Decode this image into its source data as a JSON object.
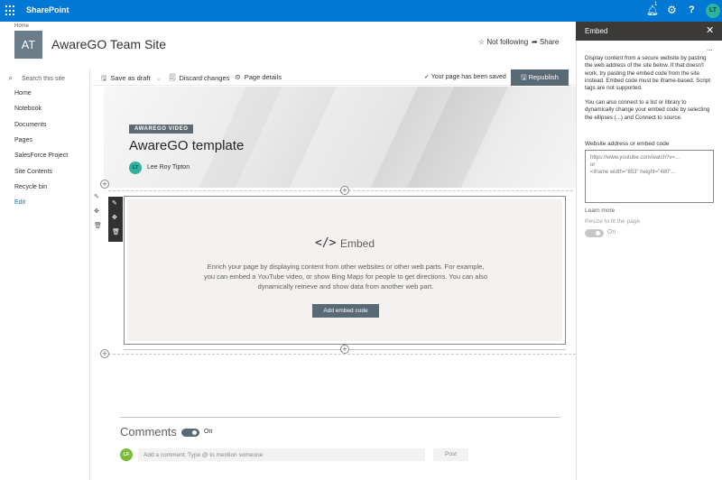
{
  "suitebar": {
    "brand": "SharePoint",
    "notification_count": "1",
    "user_initials": "LT"
  },
  "site": {
    "breadcrumb": "Home",
    "logo_initials": "AT",
    "title": "AwareGO Team Site",
    "follow_label": "Not following",
    "share_label": "Share"
  },
  "leftnav": {
    "search_placeholder": "Search this site",
    "items": [
      "Home",
      "Notebook",
      "Documents",
      "Pages",
      "SalesForce Project",
      "Site Contents",
      "Recycle bin"
    ],
    "edit_label": "Edit"
  },
  "commandbar": {
    "save_draft": "Save as draft",
    "discard": "Discard changes",
    "page_details": "Page details",
    "saved_status": "Your page has been saved",
    "republish": "Republish"
  },
  "hero": {
    "tag": "AWAREGO VIDEO",
    "title": "AwareGO template",
    "author_initials": "LT",
    "author_name": "Lee Roy Tipton"
  },
  "embed_webpart": {
    "glyph": "</>",
    "title": "Embed",
    "description": "Enrich your page by displaying content from other websites or other web parts. For example, you can embed a YouTube video, or show Bing Maps for people to get directions. You can also dynamically retrieve and show data from another web part.",
    "button": "Add embed code"
  },
  "comments": {
    "title": "Comments",
    "toggle_state": "On",
    "commenter_initials": "LF",
    "input_placeholder": "Add a comment. Type @ to mention someone",
    "post_label": "Post"
  },
  "panel": {
    "title": "Embed",
    "more": "...",
    "para1": "Display content from a secure website by pasting the web address of the site below. If that doesn't work, try pasting the embed code from the site instead. Embed code must be iframe-based. Script tags are not supported.",
    "para2": "You can also connect to a list or library to dynamically change your embed code by selecting the ellipses (...) and Connect to source.",
    "address_label": "Website address or embed code",
    "address_placeholder": "https://www.youtube.com/watch?v=...\nor\n<iframe width=\"853\" height=\"480\"...",
    "learn_more": "Learn more",
    "resize_label": "Resize to fit the page",
    "resize_state": "On"
  },
  "colors": {
    "suitebar": "#0078d4",
    "accent_button": "#5a6a75",
    "panel_header": "#3b3a39",
    "avatar_teal": "#2fb39f"
  }
}
